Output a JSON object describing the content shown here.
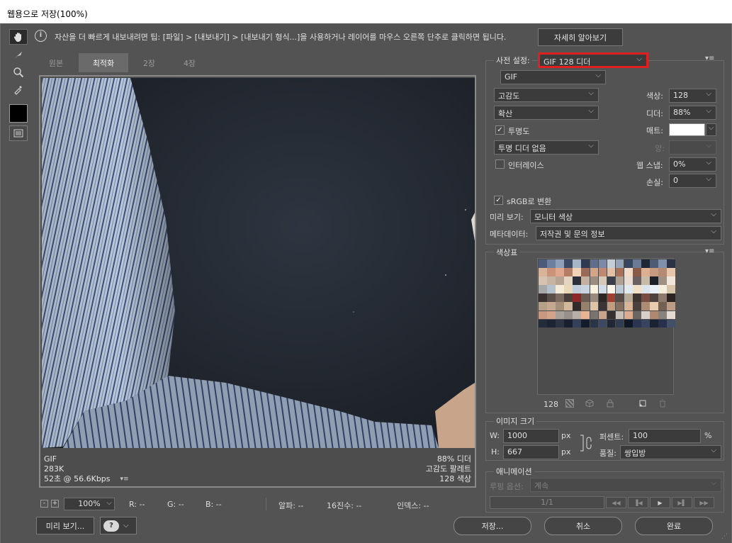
{
  "window": {
    "title": "웹용으로 저장(100%)"
  },
  "tip": {
    "text": "자산을 더 빠르게 내보내려면 팁: [파일] > [내보내기] > [내보내기 형식...]을 사용하거나 레이어를 마우스 오른쪽 단추로 클릭하면 됩니다.",
    "learn_more": "자세히 알아보기"
  },
  "tabs": [
    {
      "label": "원본",
      "active": false
    },
    {
      "label": "최적화",
      "active": true
    },
    {
      "label": "2장",
      "active": false
    },
    {
      "label": "4장",
      "active": false
    }
  ],
  "canvas_info": {
    "left": [
      "GIF",
      "283K",
      "52초 @ 56.6Kbps"
    ],
    "right": [
      "88% 디더",
      "고감도 팔레트",
      "128 색상"
    ]
  },
  "statusbar": {
    "zoom": "100%",
    "r": "R: --",
    "g": "G: --",
    "b": "B: --",
    "alpha": "알파: --",
    "hex": "16진수: --",
    "index": "인덱스: --"
  },
  "bottom_left": {
    "preview": "미리 보기..."
  },
  "actions": {
    "save": "저장...",
    "cancel": "취소",
    "done": "완료"
  },
  "preset": {
    "label": "사전 설정:",
    "value": "GIF 128 디더"
  },
  "format": "GIF",
  "settings": {
    "reduction": "고감도",
    "dither_algo": "확산",
    "transparency_label": "투명도",
    "transparency_checked": true,
    "transparency_dither": "투명 디더 없음",
    "interlace_label": "인터레이스",
    "interlace_checked": false,
    "colors_label": "색상:",
    "colors_value": "128",
    "dither_label": "디더:",
    "dither_value": "88%",
    "matte_label": "매트:",
    "amount_label": "양:",
    "web_snap_label": "웹 스냅:",
    "web_snap_value": "0%",
    "lossy_label": "손실:",
    "lossy_value": "0"
  },
  "srgb": {
    "label": "sRGB로 변환",
    "checked": true
  },
  "preview_row": {
    "label": "미리 보기:",
    "value": "모니터 색상"
  },
  "metadata_row": {
    "label": "메타데이터:",
    "value": "저작권 및 문의 정보"
  },
  "color_table": {
    "title": "색상표",
    "count": "128",
    "colors": [
      "#4a5a78",
      "#6d7f9f",
      "#8ea0ba",
      "#3c4a66",
      "#a8b5c8",
      "#2f3a52",
      "#5e6e8c",
      "#7a8aa8",
      "#c4cdd8",
      "#95a3b8",
      "#394660",
      "#6b7a95",
      "#202838",
      "#4d5b75",
      "#8090aa",
      "#2a3244",
      "#d8b59a",
      "#c9937a",
      "#e0a88c",
      "#b57c66",
      "#f0d2b8",
      "#9a6a58",
      "#d4a486",
      "#c08870",
      "#e6c0a4",
      "#a87058",
      "#f2dcc8",
      "#8a5a48",
      "#dcb090",
      "#c69a80",
      "#b48a74",
      "#e8c6ac",
      "#d6c2ae",
      "#c8b4a2",
      "#b8a492",
      "#e4d4c2",
      "#2a2f3a",
      "#c4b0a0",
      "#9c8c80",
      "#d8c8b8",
      "#3a3f4a",
      "#b0a094",
      "#e8dcd0",
      "#6a6060",
      "#cabaa8",
      "#1c2028",
      "#a09084",
      "#f0e6dc",
      "#a8a8a8",
      "#b4c0cc",
      "#f4ecd8",
      "#e8d8b8",
      "#c0ccd8",
      "#c8d4e0",
      "#f8f0e0",
      "#d0dce8",
      "#fcf6ea",
      "#bcc8d4",
      "#e0e8f0",
      "#f0e0c8",
      "#dce4ec",
      "#e8f0f6",
      "#f6eedc",
      "#d8c4a8",
      "#3a3230",
      "#5c4e48",
      "#7a6a60",
      "#4a3e3a",
      "#8c2828",
      "#6a5a52",
      "#9a8a7e",
      "#2e2624",
      "#a04030",
      "#584a44",
      "#b8a898",
      "#3e3430",
      "#784c40",
      "#4e423e",
      "#8e7a6c",
      "#2c2422",
      "#b4a088",
      "#c4a890",
      "#a49078",
      "#d4b89c",
      "#302a2a",
      "#94806c",
      "#e0c4a6",
      "#3c3434",
      "#c09c80",
      "#846e5e",
      "#d8b498",
      "#4a4040",
      "#ac8c72",
      "#e8ccb0",
      "#746052",
      "#bc9c84",
      "#c89880",
      "#d4a48a",
      "#a8a098",
      "#98908a",
      "#b8b0a8",
      "#e8b494",
      "#7a7470",
      "#cca28a",
      "#38302e",
      "#c8c0b8",
      "#dcac90",
      "#6c6662",
      "#d8d0c8",
      "#b08870",
      "#88827e",
      "#e4dcd4",
      "#242c3c",
      "#1c2434",
      "#2c3444",
      "#182030",
      "#34405a",
      "#141c2c",
      "#283448",
      "#3c4864",
      "#202838",
      "#303c52",
      "#101828",
      "#2a3650",
      "#38445e",
      "#1a2232",
      "#26304a",
      "#44506a"
    ]
  },
  "image_size": {
    "title": "이미지 크기",
    "w_label": "W:",
    "w_value": "1000",
    "h_label": "H:",
    "h_value": "667",
    "unit": "px",
    "percent_label": "퍼센트:",
    "percent_value": "100",
    "percent_unit": "%",
    "quality_label": "품질:",
    "quality_value": "쌍입방"
  },
  "animation": {
    "title": "애니메이션",
    "loop_label": "루핑 옵션:",
    "loop_value": "계속",
    "frame": "1/1"
  }
}
